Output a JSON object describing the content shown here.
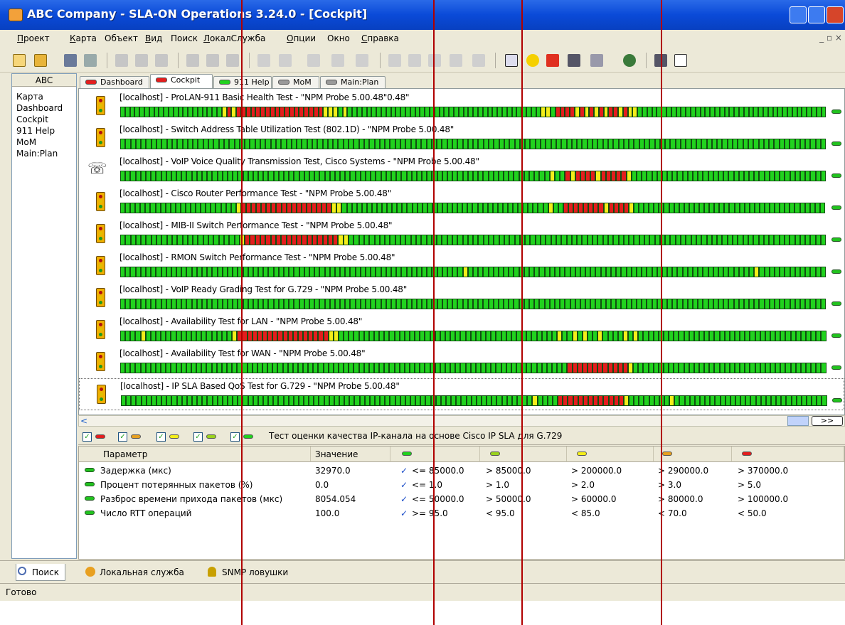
{
  "window": {
    "title": "ABC Company - SLA-ON Operations 3.24.0 - [Cockpit]"
  },
  "menu": [
    {
      "label": "Проект",
      "u": "П",
      "rest": "роект"
    },
    {
      "label": "Карта",
      "u": "К",
      "rest": "арта"
    },
    {
      "label": "Объект",
      "u": "",
      "rest": "Объект"
    },
    {
      "label": "Вид",
      "u": "В",
      "rest": "ид"
    },
    {
      "label": "Поиск",
      "u": "",
      "rest": "Поиск"
    },
    {
      "label": "ЛокалСлужба",
      "u": "Л",
      "rest": "окалСлужба"
    },
    {
      "label": "Опции",
      "u": "О",
      "rest": "пции"
    },
    {
      "label": "Окно",
      "u": "",
      "rest": "Окно"
    },
    {
      "label": "Справка",
      "u": "С",
      "rest": "правка"
    }
  ],
  "sidebar": {
    "header": "ABC",
    "items": [
      "Карта",
      "Dashboard",
      "Cockpit",
      "911 Help",
      "MoM",
      "Main:Plan"
    ]
  },
  "tabs": [
    {
      "label": "Dashboard",
      "color": "#e41d1d"
    },
    {
      "label": "Cockpit",
      "color": "#e41d1d",
      "active": true
    },
    {
      "label": "911 Help",
      "color": "#21d21e"
    },
    {
      "label": "MoM",
      "color": "#9a9a9a"
    },
    {
      "label": "Main:Plan",
      "color": "#9a9a9a"
    }
  ],
  "tests": [
    {
      "name": "[localhost] - ProLAN-911 Basic Health Test - \"NPM Probe 5.00.48\"0.48\"",
      "icon": "traffic-light",
      "bars": "gggggggggggggggggggggyryrrrrrrrrrrrrrrrrrryyygyggggggggggggggggggggggggggggggggggggggggyygrrrryryryryrryryyggggggggggggggggggggggggggggggggggggggg"
    },
    {
      "name": "[localhost] - Switch Address Table Utilization Test (802.1D) - \"NPM Probe 5.00.48\"",
      "icon": "traffic-light",
      "bars": "gggggggggggggggggggggggggggggggggggggggggggggggggggggggggggggggggggggggggggggggggggggggggggggggggggggggggggggggggggggggggggggggggggggggg"
    },
    {
      "name": "[localhost] - VoIP Voice Quality Transmission Test, Cisco Systems - \"NPM Probe 5.00.48\"",
      "icon": "phone",
      "bars": "ggggggggggggggggggggggggggggggggggggggggggggggggggggggggggggggggggggggggggggggggggggyggryrrrryrrrrrygggggggggggggggggggggggggggggggggggggg"
    },
    {
      "name": "[localhost] - Cisco Router Performance Test - \"NPM Probe 5.00.48\"",
      "icon": "traffic-light",
      "bars": "gggggggggggggggggggggggyrrrrrrrrrrrrrrrrrryygggggggggggggggggggggggggggggggggggggggggyggrrrrrrrryrrrrygggggggggggggggggggggggggggggggggggggg"
    },
    {
      "name": "[localhost] - MIB-II Switch Performance Test - \"NPM Probe 5.00.48\"",
      "icon": "traffic-light",
      "bars": "gggggggggggggggggggggggyrrrrrrrrrrrrrrrrrryygggggggggggggggggggggggggggggggggggggggggggggggggggggggggggggggggggggggggggggggggggggggggggg"
    },
    {
      "name": "[localhost] - RMON Switch Performance Test - \"NPM Probe 5.00.48\"",
      "icon": "traffic-light",
      "bars": "gggggggggggggggggggggggggggggggggggggggggggggggggggggggggggggggggggyggggggggggggggggggggggggggggggggggggggggggggggggggggggggyggggggggggggg"
    },
    {
      "name": "[localhost] - VoIP Ready Grading Test for G.729 - \"NPM Probe 5.00.48\"",
      "icon": "traffic-light",
      "bars": "gggggggggggggggggggggggggggggggggggggggggggggggggggggggggggggggggggggggggggggggggggggggggggggggggggggggggggggggggggggggggggggggggggggggggg"
    },
    {
      "name": "[localhost] - Availability Test for LAN - \"NPM Probe 5.00.48\"",
      "icon": "traffic-light",
      "bars": "ggggygggggggggggggggggyrrrrrrrrrrrrrrrrrryygggggggggggggggggggggggggggggggggggggggggggyggygyggyggggygyggggggggggggggggggggggggggggggggggggg"
    },
    {
      "name": "[localhost] - Availability Test for WAN - \"NPM Probe 5.00.48\"",
      "icon": "traffic-light",
      "bars": "ggggggggggggggggggggggggggggggggggggggggggggggggggggggggggggggggggggggggggggggggggggggggrrrrrrrrrrrrygggggggggggggggggggggggggggggggggggggg"
    },
    {
      "name": "[localhost] - IP SLA Based QoS Test for G.729 - \"NPM Probe 5.00.48\"",
      "icon": "traffic-light",
      "selected": true,
      "bars": "gggggggggggggggggggggggggggggggggggggggggggggggggggggggggggggggggggggggggggggggggyggggrrrrrrrrrrrrryggggggggygggggggggggggggggggggggggggggg"
    }
  ],
  "scroll": {
    "left_arrow": "<",
    "right_arrow": ">",
    "jump": ">>"
  },
  "filter": {
    "description": "Тест оценки качества IP-канала на основе Cisco IP SLA для G.729"
  },
  "grid": {
    "headers": [
      "Параметр",
      "Значение",
      "",
      "",
      "",
      "",
      ""
    ],
    "rows": [
      [
        "Задержка (мкс)",
        "32970.0",
        "<= 85000.0",
        "> 85000.0",
        "> 200000.0",
        "> 290000.0",
        "> 370000.0"
      ],
      [
        "Процент потерянных пакетов (%)",
        "0.0",
        "<= 1.0",
        "> 1.0",
        "> 2.0",
        "> 3.0",
        "> 5.0"
      ],
      [
        "Разброс времени прихода пакетов (мкс)",
        "8054.054",
        "<= 50000.0",
        "> 50000.0",
        "> 60000.0",
        "> 80000.0",
        "> 100000.0"
      ],
      [
        "Число RTT операций",
        "100.0",
        ">= 95.0",
        "< 95.0",
        "< 85.0",
        "< 70.0",
        "< 50.0"
      ]
    ]
  },
  "bottom_tabs": [
    "Поиск",
    "Локальная служба",
    "SNMP ловушки"
  ],
  "status": "Готово",
  "colors": {
    "green": "#21d21e",
    "yellow": "#f4ee1a",
    "red": "#e41d1d",
    "title_blue": "#0a4ad8"
  }
}
